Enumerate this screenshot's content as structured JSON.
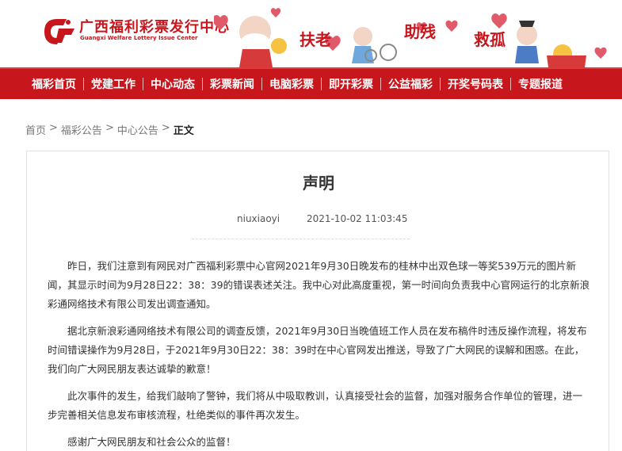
{
  "header": {
    "site_name": "广西福利彩票发行中心",
    "site_name_en": "Guangxi Welfare Lottery Issue Center",
    "slogans": [
      "扶老",
      "助残",
      "救孤"
    ]
  },
  "nav": {
    "items": [
      "福彩首页",
      "党建工作",
      "中心动态",
      "彩票新闻",
      "电脑彩票",
      "即开彩票",
      "公益福彩",
      "开奖号码表",
      "专题报道"
    ]
  },
  "breadcrumb": {
    "items": [
      "首页",
      "福彩公告",
      "中心公告"
    ],
    "separator": ">",
    "current": "正文"
  },
  "article": {
    "title": "声明",
    "author": "niuxiaoyi",
    "datetime": "2021-10-02 11:03:45",
    "paragraphs": [
      "昨日，我们注意到有网民对广西福利彩票中心官网2021年9月30日晚发布的桂林中出双色球一等奖539万元的图片新闻，其显示时间为9月28日22：38：39的错误表述关注。我中心对此高度重视，第一时间向负责我中心官网运行的北京新浪彩通网络技术有限公司发出调查通知。",
      "据北京新浪彩通网络技术有限公司的调查反馈，2021年9月30日当晚值班工作人员在发布稿件时违反操作流程，将发布时间错误操作为9月28日，于2021年9月30日22：38：39时在中心官网发出推送，导致了广大网民的误解和困惑。在此，我们向广大网民朋友表达诚挚的歉意！",
      "此次事件的发生，给我们敲响了警钟，我们将从中吸取教训，认真接受社会的监督，加强对服务合作单位的管理，进一步完善相关信息发布审核流程，杜绝类似的事件再次发生。",
      "感谢广大网民朋友和社会公众的监督！"
    ]
  },
  "colors": {
    "brand_red": "#c8161d",
    "text": "#333333",
    "muted": "#777777"
  }
}
